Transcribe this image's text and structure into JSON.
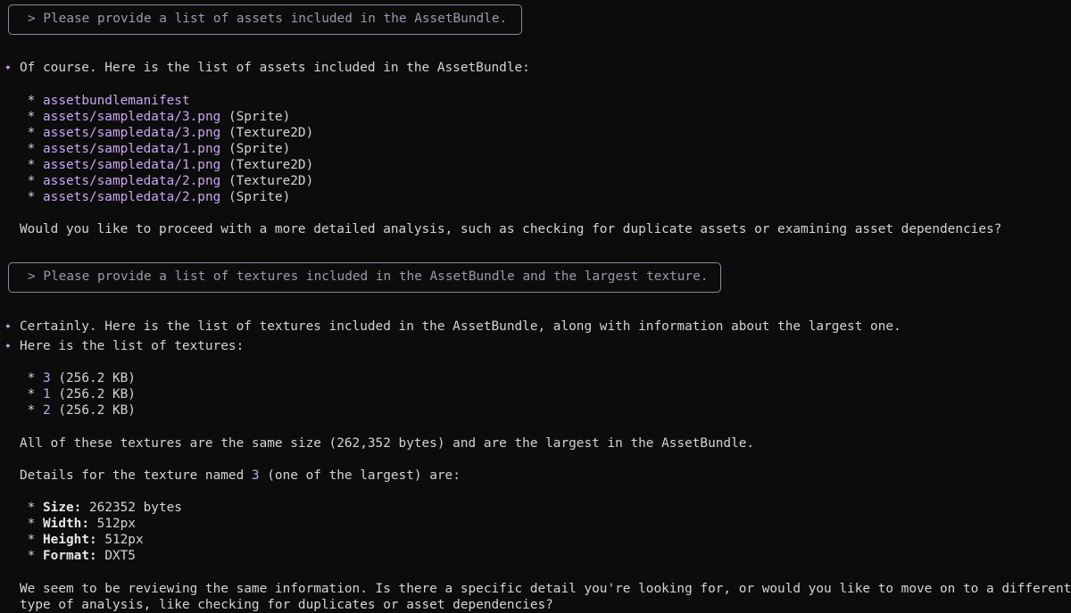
{
  "prompts": [
    "> Please provide a list of assets included in the AssetBundle.",
    "> Please provide a list of textures included in the AssetBundle and the largest texture."
  ],
  "response1": {
    "intro": "Of course. Here is the list of assets included in the AssetBundle:",
    "assets": [
      {
        "name": "assetbundlemanifest",
        "type": ""
      },
      {
        "name": "assets/sampledata/3.png",
        "type": " (Sprite)"
      },
      {
        "name": "assets/sampledata/3.png",
        "type": " (Texture2D)"
      },
      {
        "name": "assets/sampledata/1.png",
        "type": " (Sprite)"
      },
      {
        "name": "assets/sampledata/1.png",
        "type": " (Texture2D)"
      },
      {
        "name": "assets/sampledata/2.png",
        "type": " (Texture2D)"
      },
      {
        "name": "assets/sampledata/2.png",
        "type": " (Sprite)"
      }
    ],
    "followup": "Would you like to proceed with a more detailed analysis, such as checking for duplicate assets or examining asset dependencies?"
  },
  "response2": {
    "intro1": "Certainly. Here is the list of textures included in the AssetBundle, along with information about the largest one.",
    "intro2": "Here is the list of textures:",
    "textures": [
      {
        "name": "3",
        "size": " (256.2 KB)"
      },
      {
        "name": "1",
        "size": " (256.2 KB)"
      },
      {
        "name": "2",
        "size": " (256.2 KB)"
      }
    ],
    "summary": "All of these textures are the same size (262,352 bytes) and are the largest in the AssetBundle.",
    "details_pre": "Details for the texture named ",
    "details_name": "3",
    "details_post": " (one of the largest) are:",
    "details": [
      {
        "label": "Size:",
        "value": " 262352 bytes"
      },
      {
        "label": "Width:",
        "value": " 512px"
      },
      {
        "label": "Height:",
        "value": " 512px"
      },
      {
        "label": "Format:",
        "value": " DXT5"
      }
    ],
    "closing1": "We seem to be reviewing the same information. Is there a specific detail you're looking for, or would you like to move on to a different",
    "closing2": "type of analysis, like checking for duplicates or asset dependencies?"
  },
  "icons": {
    "sparkle": "✦",
    "bullet": "*"
  }
}
